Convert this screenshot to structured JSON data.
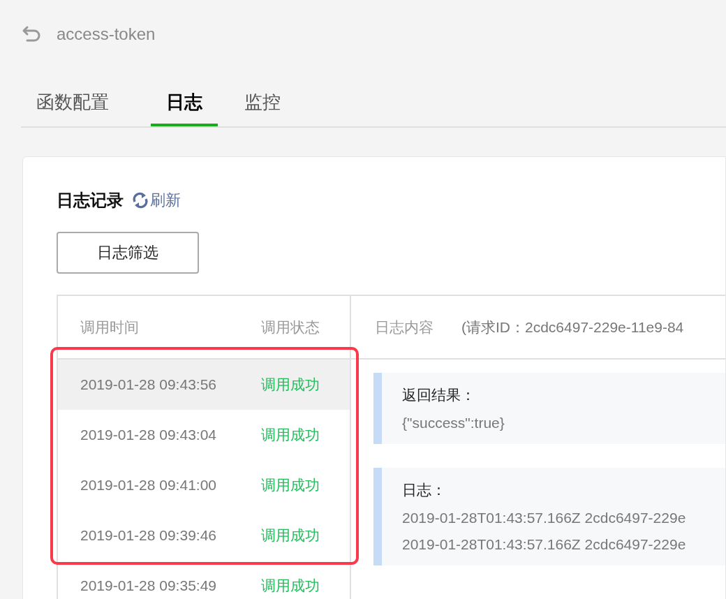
{
  "header": {
    "title": "access-token"
  },
  "tabs": [
    {
      "label": "函数配置",
      "selected": false
    },
    {
      "label": "日志",
      "selected": true
    },
    {
      "label": "监控",
      "selected": false
    }
  ],
  "card": {
    "title": "日志记录",
    "refresh": "刷新",
    "filter_button": "日志筛选"
  },
  "table": {
    "columns": [
      "调用时间",
      "调用状态"
    ],
    "rows": [
      {
        "time": "2019-01-28 09:43:56",
        "status": "调用成功",
        "selected": true
      },
      {
        "time": "2019-01-28 09:43:04",
        "status": "调用成功",
        "selected": false
      },
      {
        "time": "2019-01-28 09:41:00",
        "status": "调用成功",
        "selected": false
      },
      {
        "time": "2019-01-28 09:39:46",
        "status": "调用成功",
        "selected": false
      },
      {
        "time": "2019-01-28 09:35:49",
        "status": "调用成功",
        "selected": false
      }
    ]
  },
  "detail": {
    "heading": "日志内容",
    "request_id": "(请求ID：2cdc6497-229e-11e9-84",
    "blocks": [
      {
        "label": "返回结果：",
        "lines": [
          "{\"success\":true}"
        ]
      },
      {
        "label": "日志：",
        "lines": [
          "2019-01-28T01:43:57.166Z 2cdc6497-229e",
          "2019-01-28T01:43:57.166Z 2cdc6497-229e"
        ]
      }
    ]
  },
  "annotation": {
    "kind": "highlight"
  }
}
